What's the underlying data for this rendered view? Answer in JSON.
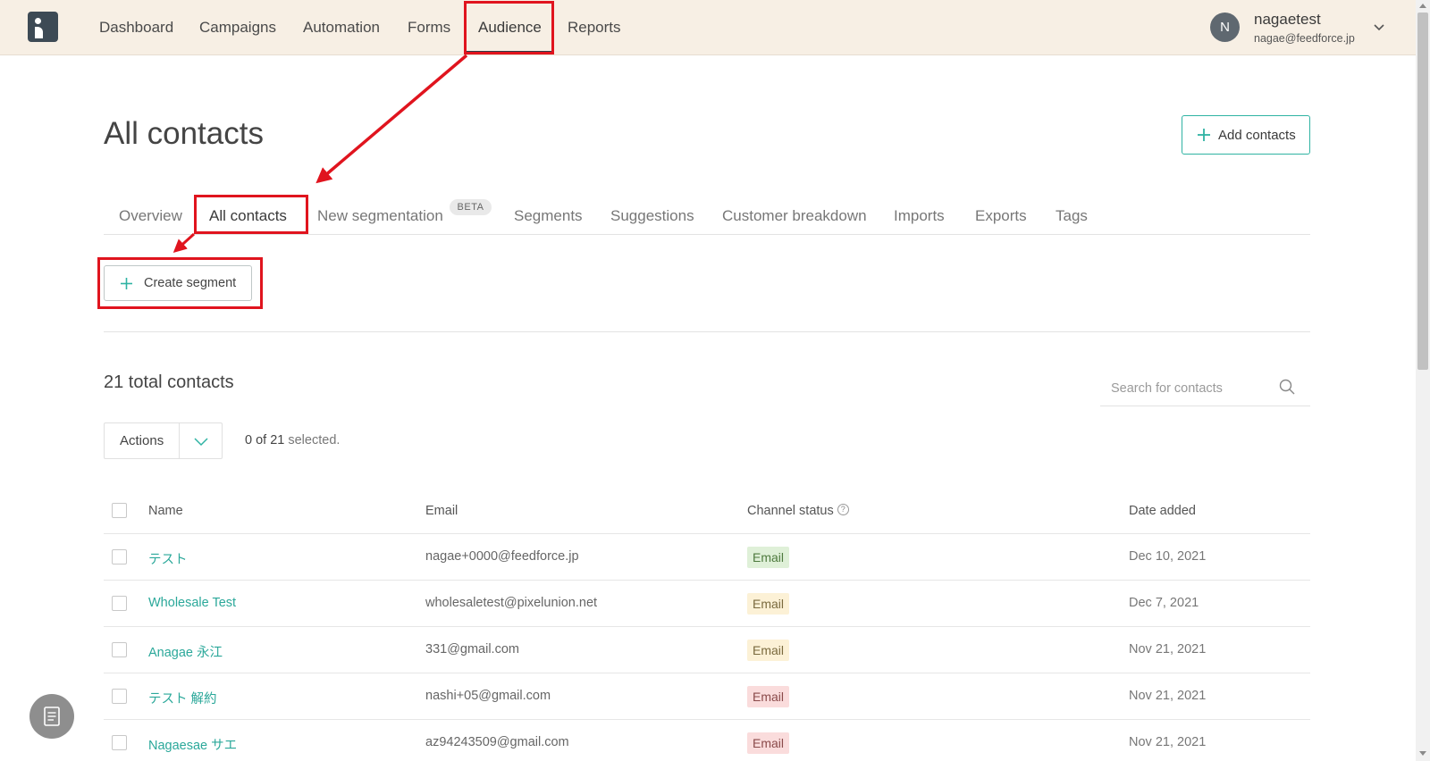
{
  "nav": {
    "items": [
      "Dashboard",
      "Campaigns",
      "Automation",
      "Forms",
      "Audience",
      "Reports"
    ],
    "active": "Audience"
  },
  "user": {
    "initial": "N",
    "name": "nagaetest",
    "email": "nagae@feedforce.jp"
  },
  "page": {
    "title": "All contacts",
    "add_contacts_label": "Add contacts"
  },
  "tabs": {
    "items": [
      "Overview",
      "All contacts",
      "New segmentation",
      "Segments",
      "Suggestions",
      "Customer breakdown",
      "Imports",
      "Exports",
      "Tags"
    ],
    "active": "All contacts",
    "beta_badge": "BETA"
  },
  "segment": {
    "create_label": "Create segment"
  },
  "contacts": {
    "total_label": "21 total contacts",
    "search_placeholder": "Search for contacts",
    "actions_label": "Actions",
    "selected_count": "0 of 21",
    "selected_suffix": " selected."
  },
  "table": {
    "headers": [
      "Name",
      "Email",
      "Channel status",
      "Date added"
    ],
    "rows": [
      {
        "name": "テスト",
        "email": "nagae+0000@feedforce.jp",
        "status": "Email",
        "status_color": "#dff0d8",
        "status_text_color": "#4e7a3e",
        "date": "Dec 10, 2021"
      },
      {
        "name": "Wholesale Test",
        "email": "wholesaletest@pixelunion.net",
        "status": "Email",
        "status_color": "#fcf1d6",
        "status_text_color": "#7a6a3e",
        "date": "Dec 7, 2021"
      },
      {
        "name": "Anagae 永江",
        "email": "331@gmail.com",
        "status": "Email",
        "status_color": "#fcf1d6",
        "status_text_color": "#7a6a3e",
        "date": "Nov 21, 2021"
      },
      {
        "name": "テスト 解約",
        "email": "nashi+05@gmail.com",
        "status": "Email",
        "status_color": "#fadcdc",
        "status_text_color": "#8a4a4a",
        "date": "Nov 21, 2021"
      },
      {
        "name": "Nagaesae サエ",
        "email": "az94243509@gmail.com",
        "status": "Email",
        "status_color": "#fadcdc",
        "status_text_color": "#8a4a4a",
        "date": "Nov 21, 2021"
      }
    ]
  },
  "colors": {
    "accent": "#2fb3a3",
    "annotation": "#e0141e",
    "topbar": "#f7efe4"
  }
}
